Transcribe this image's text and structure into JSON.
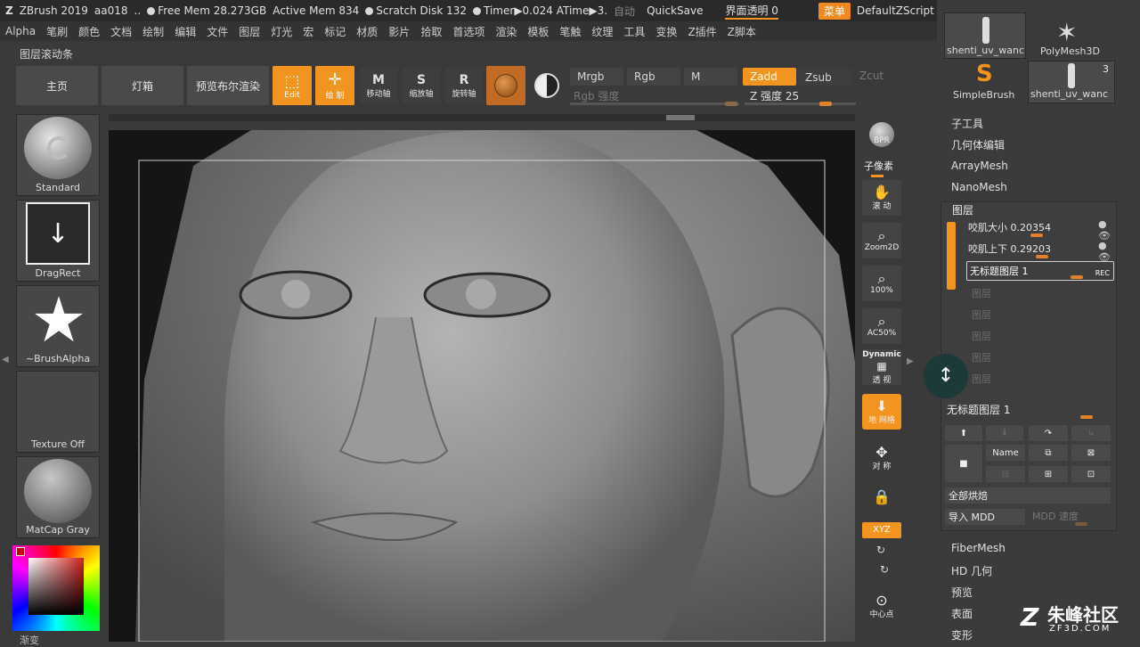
{
  "titlebar": {
    "app": "ZBrush 2019",
    "doc": "aa018",
    "sep": "..",
    "free_mem": "Free Mem 28.273GB",
    "active_mem": "Active Mem 834",
    "scratch": "Scratch Disk 132",
    "timer": "Timer▶0.024 ATime▶3.",
    "auto": "自动",
    "quicksave": "QuickSave",
    "ui_trans": "界面透明 0",
    "menu_btn": "菜单",
    "script": "DefaultZScript"
  },
  "menubar": [
    "Alpha",
    "笔刷",
    "颜色",
    "文档",
    "绘制",
    "编辑",
    "文件",
    "图层",
    "灯光",
    "宏",
    "标记",
    "材质",
    "影片",
    "拾取",
    "首选项",
    "渲染",
    "模板",
    "笔触",
    "纹理",
    "工具",
    "变换",
    "Z插件",
    "Z脚本"
  ],
  "palette_title": "图层滚动条",
  "toolbar": {
    "home": "主页",
    "lightbox": "灯箱",
    "bpr": "预览布尔渲染",
    "edit": "Edit",
    "draw": "绘 制",
    "move": "移动轴",
    "scale": "缩放轴",
    "rotate": "旋转轴",
    "mrgb": "Mrgb",
    "rgb": "Rgb",
    "m": "M",
    "zadd": "Zadd",
    "zsub": "Zsub",
    "zcut": "Zcut",
    "rgb_intensity": "Rgb 强度",
    "z_intensity": "Z 强度 25"
  },
  "left": {
    "brush": "Standard",
    "stroke": "DragRect",
    "alpha": "~BrushAlpha",
    "texture": "Texture Off",
    "material": "MatCap Gray",
    "gradient": "渐变"
  },
  "right_tools": {
    "bpr": "BPR",
    "subpixel": "子像素",
    "scroll": "滚 动",
    "zoom2d": "Zoom2D",
    "p100": "100%",
    "ac50": "AC50%",
    "dynamic": "Dynamic",
    "persp": "透 视",
    "floor": "地 网格",
    "align": "对 称",
    "lock": "",
    "xyz": "XYZ",
    "center": "中心点"
  },
  "rpanel": {
    "thumbs": [
      "shenti_uv_wanc",
      "PolyMesh3D",
      "SimpleBrush",
      "shenti_uv_wanc"
    ],
    "count": "3",
    "items_top": [
      "子工具",
      "几何体编辑",
      "ArrayMesh",
      "NanoMesh"
    ],
    "layers_header": "图层",
    "layers": [
      {
        "name": "咬肌大小",
        "value": "0.20354"
      },
      {
        "name": "咬肌上下",
        "value": "0.29203"
      },
      {
        "name": "无标题图层",
        "value": "1"
      }
    ],
    "rec": "REC",
    "ghost": [
      "图层",
      "图层",
      "图层",
      "图层",
      "图层"
    ],
    "selected_layer": "无标题图层 1",
    "name_btn": "Name",
    "bake": "全部烘焙",
    "import_mdd": "导入 MDD",
    "mdd_speed": "MDD 速度",
    "items_bottom": [
      "FiberMesh",
      "HD 几何",
      "预览",
      "表面",
      "变形"
    ]
  },
  "watermark": {
    "text": "朱峰社区",
    "url": "ZF3D.COM"
  },
  "colors": {
    "accent": "#f39320",
    "bg": "#3a3a3a",
    "panel": "#3b3b3b"
  }
}
